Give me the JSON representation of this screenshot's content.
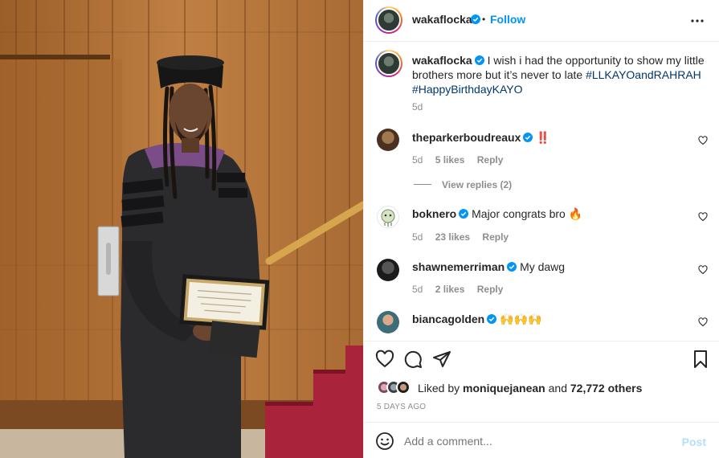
{
  "post": {
    "author": "wakaflocka",
    "follow_label": "Follow",
    "dot": "•",
    "more_icon": "more-horizontal-icon",
    "caption_text": "I wish i had the opportunity to show my little brothers more but it’s never to late",
    "caption_tag1": "#LLKAYOandRAHRAH",
    "caption_tag2": "#HappyBirthdayKAYO",
    "caption_time": "5d"
  },
  "comments": [
    {
      "user": "theparkerboudreaux",
      "text": "‼️",
      "time": "5d",
      "likes": "5 likes",
      "reply": "Reply",
      "view_replies": "View replies (2)"
    },
    {
      "user": "boknero",
      "text": "Major congrats bro 🔥",
      "time": "5d",
      "likes": "23 likes",
      "reply": "Reply"
    },
    {
      "user": "shawnemerriman",
      "text": "My dawg",
      "time": "5d",
      "likes": "2 likes",
      "reply": "Reply"
    },
    {
      "user": "biancagolden",
      "text": "🙌🙌🙌",
      "time": "",
      "likes": "",
      "reply": ""
    }
  ],
  "actions": {
    "like_icon": "heart-icon",
    "comment_icon": "comment-icon",
    "share_icon": "paper-plane-icon",
    "save_icon": "bookmark-icon"
  },
  "liked_by": {
    "prefix": "Liked by",
    "user": "moniquejanean",
    "middle": "and",
    "others": "72,772 others"
  },
  "post_date": "5 DAYS AGO",
  "add_comment": {
    "placeholder": "Add a comment...",
    "post_label": "Post"
  },
  "colors": {
    "accent": "#0095f6",
    "hashtag": "#00376b",
    "muted": "#8e8e8e",
    "emoji_red": "#e0245e"
  }
}
